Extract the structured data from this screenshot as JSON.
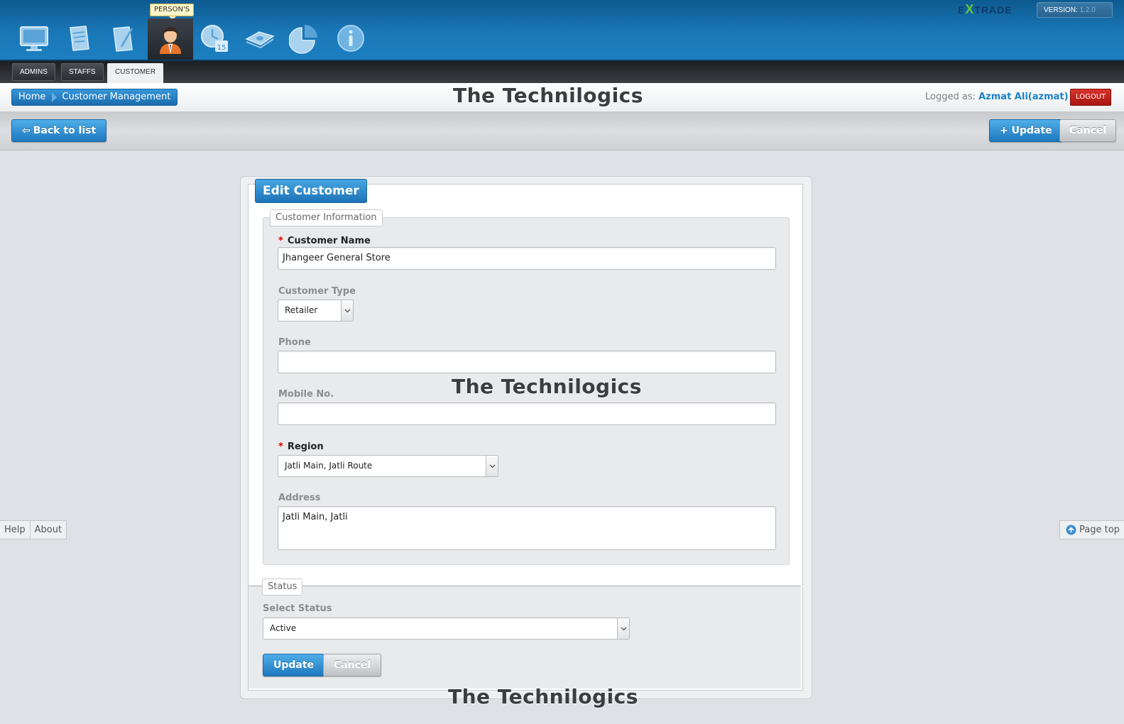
{
  "topbar": {
    "active_module_tip": "PERSON'S",
    "brand": {
      "e": "E",
      "x": "X",
      "trade": "TRADE"
    },
    "version_label": "VERSION:",
    "version_value": "1.2.0",
    "modules": [
      {
        "icon": "monitor-icon"
      },
      {
        "icon": "document-edit-icon"
      },
      {
        "icon": "document-pen-icon"
      },
      {
        "icon": "person-icon"
      },
      {
        "icon": "calendar-clock-icon"
      },
      {
        "icon": "money-icon"
      },
      {
        "icon": "pie-chart-icon"
      },
      {
        "icon": "info-icon"
      }
    ]
  },
  "tabs": [
    "ADMINS",
    "STAFFS",
    "CUSTOMER"
  ],
  "header": {
    "breadcrumb": [
      "Home",
      "Customer Management"
    ],
    "title": "The Technilogics",
    "logged_as_label": "Logged as:",
    "logged_user": "Azmat Ali(azmat)",
    "logout_label": "LOGOUT"
  },
  "actions": {
    "back_label": "Back to list",
    "update_label": "+ Update",
    "cancel_label": "Cancel"
  },
  "form": {
    "title": "Edit Customer",
    "section_info": "Customer Information",
    "customer_name_label": "Customer Name",
    "customer_name_value": "Jhangeer General Store",
    "customer_type_label": "Customer Type",
    "customer_type_value": "Retailer",
    "phone_label": "Phone",
    "phone_value": "",
    "mobile_label": "Mobile No.",
    "mobile_value": "",
    "region_label": "Region",
    "region_value": "Jatli Main, Jatli Route",
    "address_label": "Address",
    "address_value": "Jatli Main, Jatli",
    "section_status": "Status",
    "select_status_label": "Select Status",
    "status_value": "Active",
    "update_label": "Update",
    "cancel_label": "Cancel",
    "required_mark": "*"
  },
  "watermark": "The Technilogics",
  "sidebar_left": [
    "Help",
    "About"
  ],
  "page_top_label": "Page top",
  "colors": {
    "topbar_blue": "#1a78b8",
    "button_blue": "#1f78bf",
    "logout_red": "#c0221b",
    "user_blue": "#1b83c6",
    "required_red": "#cc0000"
  }
}
